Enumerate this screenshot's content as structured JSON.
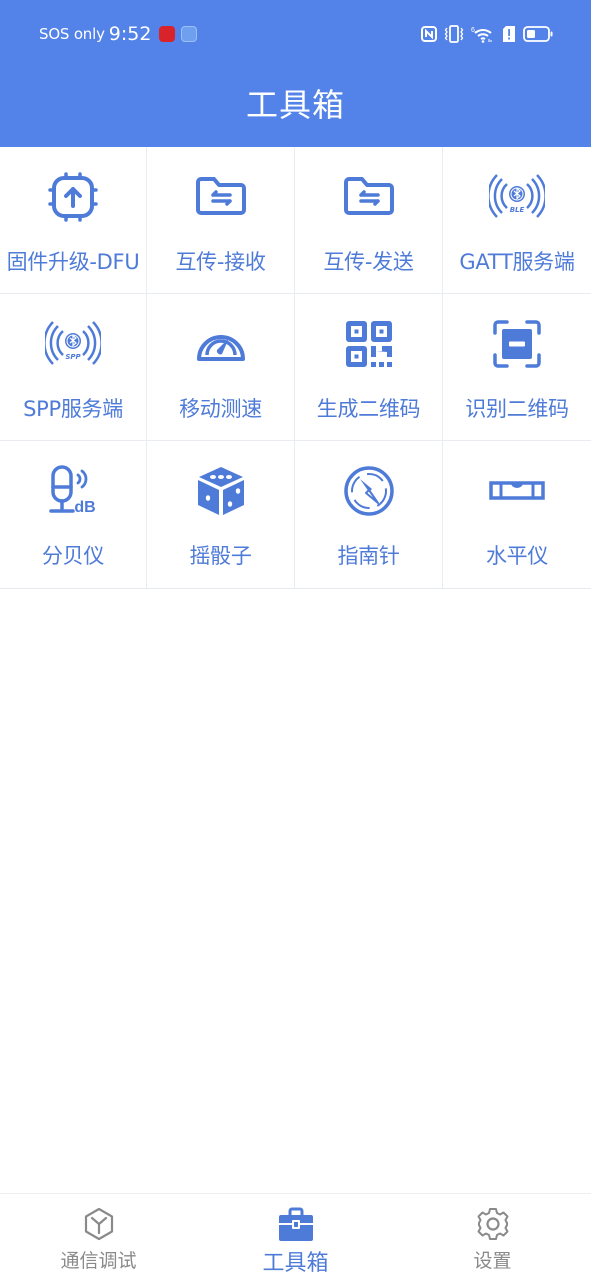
{
  "status_bar": {
    "carrier_text": "SOS only",
    "time": "9:52",
    "icons": [
      "app-notification-red-icon",
      "app-notification-blue-icon",
      "nfc-icon",
      "vibrate-icon",
      "wifi-6-icon",
      "sim-alert-icon",
      "battery-icon"
    ],
    "battery_level": 0.3
  },
  "header": {
    "title": "工具箱"
  },
  "colors": {
    "accent": "#5383e8",
    "label": "#4f7bd8",
    "inactive": "#8a8a8a"
  },
  "tools": [
    {
      "label": "固件升级-DFU",
      "icon": "firmware-upgrade-icon"
    },
    {
      "label": "互传-接收",
      "icon": "folder-transfer-icon"
    },
    {
      "label": "互传-发送",
      "icon": "folder-transfer-icon"
    },
    {
      "label": "GATT服务端",
      "icon": "ble-broadcast-icon",
      "icon_text": "BLE"
    },
    {
      "label": "SPP服务端",
      "icon": "spp-broadcast-icon",
      "icon_text": "SPP"
    },
    {
      "label": "移动测速",
      "icon": "speedometer-icon"
    },
    {
      "label": "生成二维码",
      "icon": "qr-code-icon"
    },
    {
      "label": "识别二维码",
      "icon": "scan-icon"
    },
    {
      "label": "分贝仪",
      "icon": "decibel-meter-icon",
      "icon_text": "dB"
    },
    {
      "label": "摇骰子",
      "icon": "dice-icon"
    },
    {
      "label": "指南针",
      "icon": "compass-icon"
    },
    {
      "label": "水平仪",
      "icon": "spirit-level-icon"
    }
  ],
  "tabbar": {
    "items": [
      {
        "label": "通信调试",
        "icon": "cube-icon",
        "active": false
      },
      {
        "label": "工具箱",
        "icon": "toolbox-icon",
        "active": true
      },
      {
        "label": "设置",
        "icon": "gear-icon",
        "active": false
      }
    ]
  }
}
